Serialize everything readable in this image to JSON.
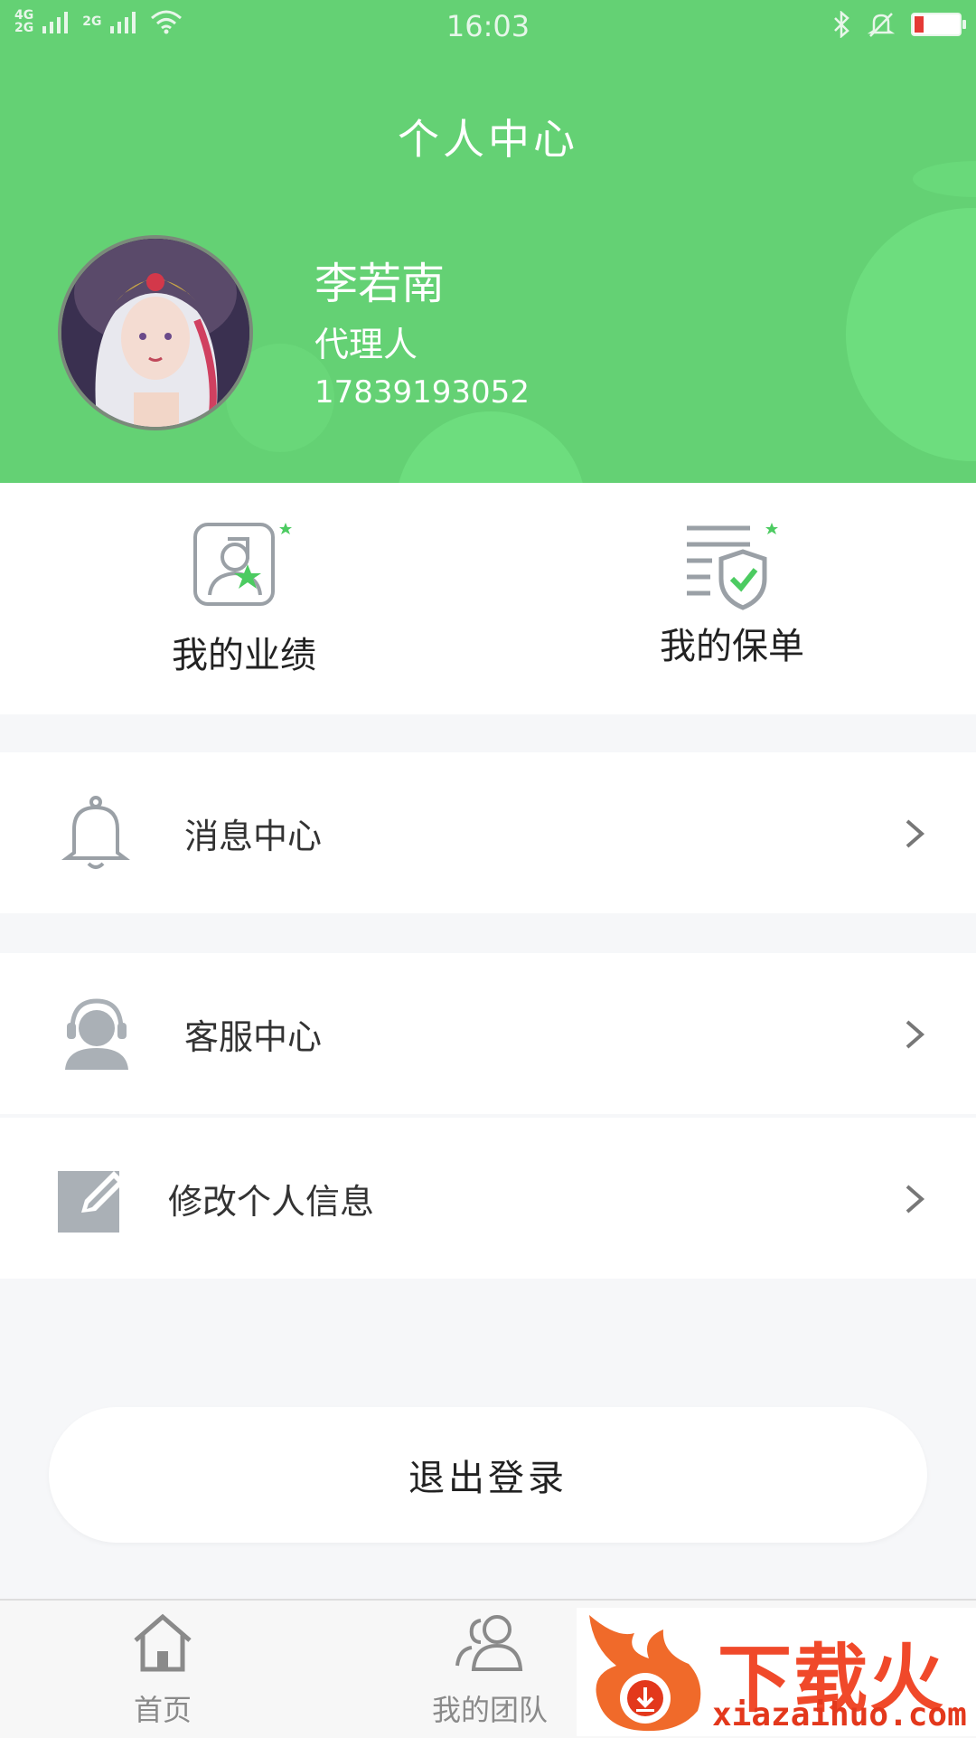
{
  "status_bar": {
    "network_top": "4G",
    "network_bottom": "2G",
    "network_2": "2G",
    "time": "16:03",
    "bluetooth_icon": "bluetooth-icon",
    "mute_icon": "bell-muted-icon",
    "battery_color": "#e53935"
  },
  "header": {
    "title": "个人中心",
    "background_color": "#64d174"
  },
  "profile": {
    "name": "李若南",
    "role": "代理人",
    "phone": "17839193052"
  },
  "quick_actions": [
    {
      "label": "我的业绩",
      "icon": "performance-icon"
    },
    {
      "label": "我的保单",
      "icon": "policy-icon"
    }
  ],
  "menu": [
    {
      "label": "消息中心",
      "icon": "bell-icon"
    },
    {
      "label": "客服中心",
      "icon": "customer-service-icon"
    },
    {
      "label": "修改个人信息",
      "icon": "edit-icon"
    }
  ],
  "logout_label": "退出登录",
  "tabbar": [
    {
      "label": "首页",
      "icon": "home-icon"
    },
    {
      "label": "我的团队",
      "icon": "team-icon"
    }
  ],
  "watermark": {
    "text": "下载火",
    "url": "xiazaihuo.com"
  }
}
